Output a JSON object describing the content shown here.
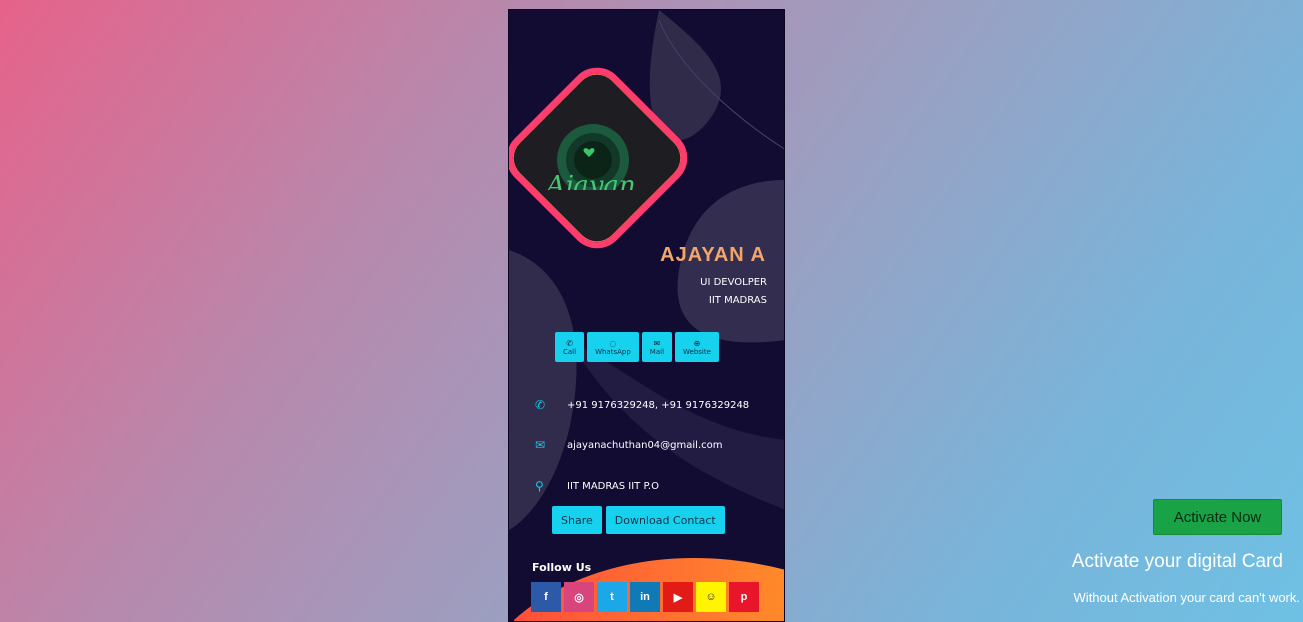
{
  "card": {
    "logo_text": "Ajayan",
    "name": "AJAYAN A",
    "role": "UI DEVOLPER",
    "organization": "IIT MADRAS",
    "actions": [
      {
        "label": "Call",
        "icon": "phone-icon",
        "glyph": "✆"
      },
      {
        "label": "WhatsApp",
        "icon": "whatsapp-icon",
        "glyph": "◌"
      },
      {
        "label": "Mail",
        "icon": "mail-icon",
        "glyph": "✉"
      },
      {
        "label": "Website",
        "icon": "globe-icon",
        "glyph": "⊕"
      }
    ],
    "phone": "+91 9176329248, +91 9176329248",
    "email": "ajayanachuthan04@gmail.com",
    "address": "IIT MADRAS IIT P.O",
    "share_label": "Share",
    "download_label": "Download Contact",
    "follow_label": "Follow Us",
    "socials": [
      {
        "name": "facebook",
        "glyph": "f",
        "color": "#3b5998"
      },
      {
        "name": "instagram",
        "glyph": "◎",
        "color": "#e1306c"
      },
      {
        "name": "twitter",
        "glyph": "t",
        "color": "#1da1f2"
      },
      {
        "name": "linkedin",
        "glyph": "in",
        "color": "#0e76a8"
      },
      {
        "name": "youtube",
        "glyph": "▶",
        "color": "#e62117"
      },
      {
        "name": "snapchat",
        "glyph": "☺",
        "color": "#fffc00"
      },
      {
        "name": "pinterest",
        "glyph": "p",
        "color": "#e60023"
      }
    ]
  },
  "activation": {
    "button_label": "Activate Now",
    "title": "Activate your digital Card",
    "subtitle": "Without Activation your card can't work."
  },
  "colors": {
    "accent": "#16d2ee",
    "name": "#f4a66a",
    "activate": "#1aa246"
  }
}
